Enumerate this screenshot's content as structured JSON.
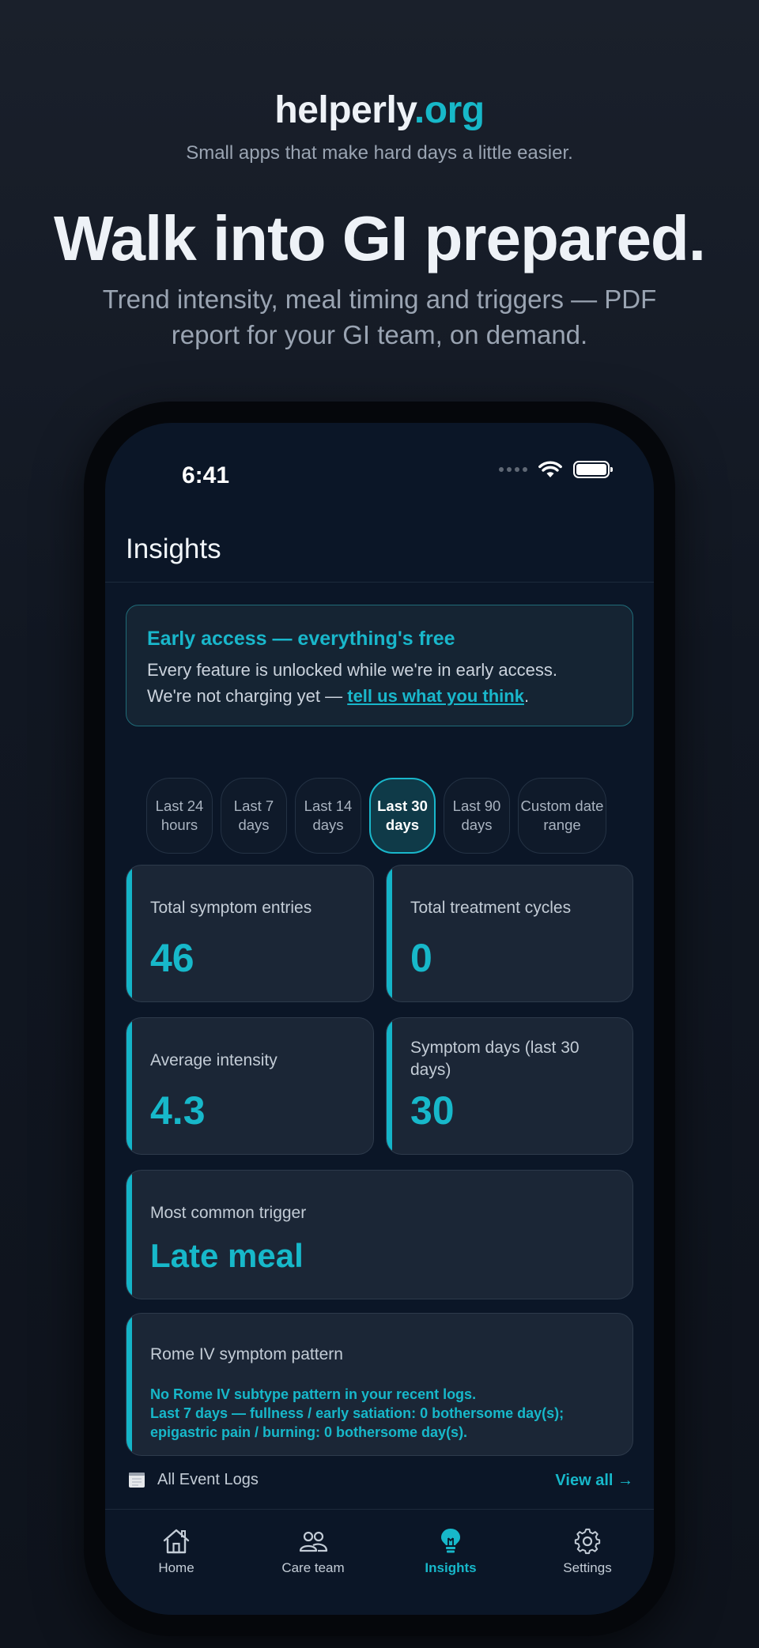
{
  "brand": {
    "name": "helperly",
    "tld": ".org",
    "tagline": "Small apps that make hard days a little easier."
  },
  "hero": {
    "headline": "Walk into GI prepared.",
    "subhead": "Trend intensity, meal timing and triggers — PDF report for your GI team, on demand."
  },
  "status": {
    "time": "6:41"
  },
  "screen": {
    "title": "Insights",
    "banner": {
      "title": "Early access — everything's free",
      "line1": "Every feature is unlocked while we're in early access.",
      "line2_prefix": "We're not charging yet — ",
      "link": "tell us what you think",
      "line2_suffix": "."
    },
    "ranges": [
      {
        "label": "Last 24 hours",
        "active": false
      },
      {
        "label": "Last 7 days",
        "active": false
      },
      {
        "label": "Last 14 days",
        "active": false
      },
      {
        "label": "Last 30 days",
        "active": true
      },
      {
        "label": "Last 90 days",
        "active": false
      },
      {
        "label": "Custom date range",
        "active": false
      }
    ],
    "stats": {
      "total_entries": {
        "label": "Total symptom entries",
        "value": "46"
      },
      "treatment_cycles": {
        "label": "Total treatment cycles",
        "value": "0"
      },
      "avg_intensity": {
        "label": "Average intensity",
        "value": "4.3"
      },
      "symptom_days": {
        "label": "Symptom days (last 30 days)",
        "value": "30"
      },
      "common_trigger": {
        "label": "Most common trigger",
        "value": "Late meal"
      }
    },
    "rome": {
      "label": "Rome IV symptom pattern",
      "line1": "No Rome IV subtype pattern in your recent logs.",
      "line2": "Last 7 days — fullness / early satiation: 0 bothersome day(s);",
      "line3": "epigastric pain / burning: 0 bothersome day(s)."
    },
    "logs": {
      "label": "All Event Logs",
      "view_all": "View all →"
    },
    "tabs": [
      {
        "label": "Home",
        "active": false
      },
      {
        "label": "Care team",
        "active": false
      },
      {
        "label": "Insights",
        "active": true
      },
      {
        "label": "Settings",
        "active": false
      }
    ]
  },
  "colors": {
    "accent": "#17b8ca",
    "background": "#0b1627",
    "card": "#1b2636"
  }
}
